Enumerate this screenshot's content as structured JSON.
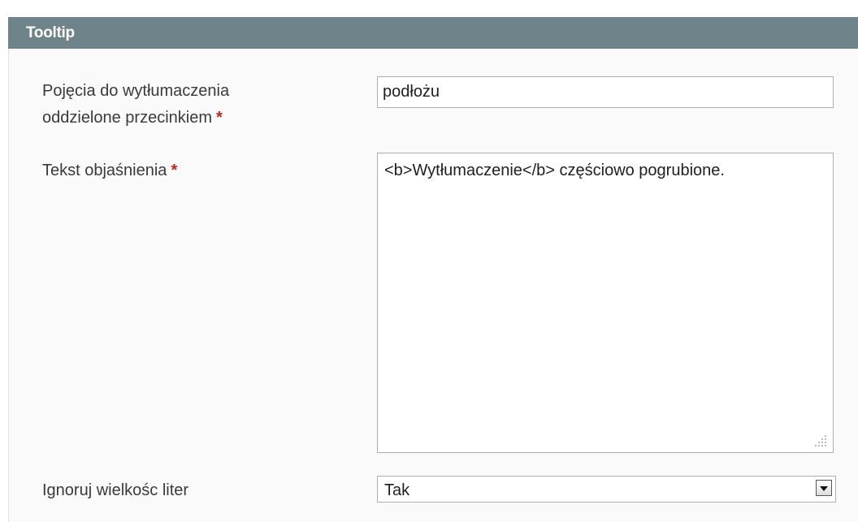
{
  "header": {
    "title": "Tooltip"
  },
  "fields": {
    "terms": {
      "label_line1": "Pojęcia do wytłumaczenia",
      "label_line2": "oddzielone przecinkiem",
      "required_mark": "*",
      "value": "podłożu"
    },
    "explanation": {
      "label": "Tekst objaśnienia",
      "required_mark": "*",
      "value": "<b>Wytłumaczenie</b> częściowo pogrubione."
    },
    "case": {
      "label": "Ignoruj wielkośc liter",
      "selected": "Tak"
    }
  },
  "icons": {
    "dropdown": "chevron-down-icon",
    "resize": "resize-grip-icon"
  },
  "colors": {
    "header_bg": "#6f838a",
    "required": "#c0261a"
  }
}
